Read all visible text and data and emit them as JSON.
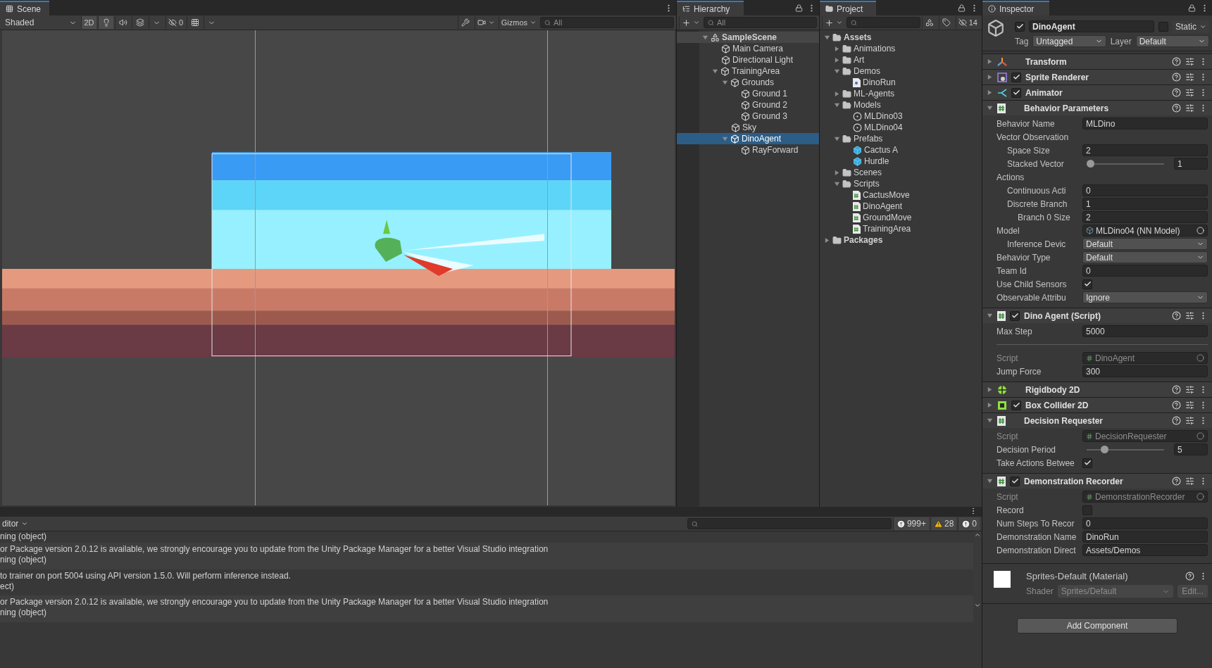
{
  "scene": {
    "tab": "Scene",
    "shading": "Shaded",
    "mode_2d": "2D",
    "hidden_count": "0",
    "gizmos": "Gizmos",
    "search_placeholder": "All"
  },
  "hierarchy": {
    "tab": "Hierarchy",
    "search_placeholder": "All",
    "items": [
      {
        "label": "SampleScene",
        "kind": "scene",
        "expanded": true,
        "selected": false,
        "children": [
          {
            "label": "Main Camera",
            "kind": "object",
            "selected": false
          },
          {
            "label": "Directional Light",
            "kind": "object",
            "selected": false
          },
          {
            "label": "TrainingArea",
            "kind": "object",
            "expanded": true,
            "selected": false,
            "children": [
              {
                "label": "Grounds",
                "kind": "object",
                "expanded": true,
                "selected": false,
                "children": [
                  {
                    "label": "Ground 1",
                    "kind": "object",
                    "selected": false
                  },
                  {
                    "label": "Ground 2",
                    "kind": "object",
                    "selected": false
                  },
                  {
                    "label": "Ground 3",
                    "kind": "object",
                    "selected": false
                  }
                ]
              },
              {
                "label": "Sky",
                "kind": "object",
                "selected": false
              },
              {
                "label": "DinoAgent",
                "kind": "object",
                "expanded": true,
                "selected": true,
                "children": [
                  {
                    "label": "RayForward",
                    "kind": "object",
                    "selected": false
                  }
                ]
              }
            ]
          }
        ]
      }
    ]
  },
  "project": {
    "tab": "Project",
    "hidden_count": "14",
    "items": [
      {
        "label": "Assets",
        "kind": "folder",
        "expanded": true,
        "children": [
          {
            "label": "Animations",
            "kind": "folder",
            "expanded": false
          },
          {
            "label": "Art",
            "kind": "folder",
            "expanded": false
          },
          {
            "label": "Demos",
            "kind": "folder",
            "expanded": true,
            "children": [
              {
                "label": "DinoRun",
                "kind": "demo"
              }
            ]
          },
          {
            "label": "ML-Agents",
            "kind": "folder",
            "expanded": false
          },
          {
            "label": "Models",
            "kind": "folder",
            "expanded": true,
            "children": [
              {
                "label": "MLDino03",
                "kind": "model"
              },
              {
                "label": "MLDino04",
                "kind": "model"
              }
            ]
          },
          {
            "label": "Prefabs",
            "kind": "folder",
            "expanded": true,
            "children": [
              {
                "label": "Cactus A",
                "kind": "prefab"
              },
              {
                "label": "Hurdle",
                "kind": "prefab"
              }
            ]
          },
          {
            "label": "Scenes",
            "kind": "folder",
            "expanded": false
          },
          {
            "label": "Scripts",
            "kind": "folder",
            "expanded": true,
            "children": [
              {
                "label": "CactusMove",
                "kind": "script"
              },
              {
                "label": "DinoAgent",
                "kind": "script"
              },
              {
                "label": "GroundMove",
                "kind": "script"
              },
              {
                "label": "TrainingArea",
                "kind": "script"
              }
            ]
          }
        ]
      },
      {
        "label": "Packages",
        "kind": "folder",
        "expanded": false
      }
    ]
  },
  "inspector": {
    "tab": "Inspector",
    "object": {
      "name": "DinoAgent",
      "active": true,
      "static_label": "Static",
      "static": false,
      "tag_label": "Tag",
      "tag": "Untagged",
      "layer_label": "Layer",
      "layer": "Default"
    },
    "components": [
      {
        "title": "Transform",
        "kind": "transform",
        "expanded": false
      },
      {
        "title": "Sprite Renderer",
        "kind": "sprite",
        "enabled": true,
        "expanded": false
      },
      {
        "title": "Animator",
        "kind": "animator",
        "enabled": true,
        "expanded": false
      },
      {
        "title": "Behavior Parameters",
        "kind": "script",
        "expanded": true,
        "fields": [
          {
            "kind": "text",
            "label": "Behavior Name",
            "value": "MLDino"
          },
          {
            "kind": "header",
            "label": "Vector Observation",
            "children": [
              {
                "kind": "text",
                "label": "Space Size",
                "value": "2"
              },
              {
                "kind": "slider",
                "label": "Stacked Vector",
                "level": 0,
                "value": "1"
              }
            ]
          },
          {
            "kind": "header",
            "label": "Actions",
            "children": [
              {
                "kind": "text",
                "label": "Continuous Acti",
                "value": "0"
              },
              {
                "kind": "text",
                "label": "Discrete Branch",
                "value": "1",
                "children": [
                  {
                    "kind": "text",
                    "label": "Branch 0 Size",
                    "value": "2"
                  }
                ]
              }
            ]
          },
          {
            "kind": "object",
            "label": "Model",
            "value": "MLDino04 (NN Model)",
            "disabled": false,
            "children": [
              {
                "kind": "dropdown",
                "label": "Inference Devic",
                "value": "Default"
              }
            ]
          },
          {
            "kind": "dropdown",
            "label": "Behavior Type",
            "value": "Default"
          },
          {
            "kind": "text",
            "label": "Team Id",
            "value": "0"
          },
          {
            "kind": "checkbox",
            "label": "Use Child Sensors",
            "checked": true
          },
          {
            "kind": "dropdown",
            "label": "Observable Attribu",
            "value": "Ignore"
          }
        ]
      },
      {
        "title": "Dino Agent (Script)",
        "kind": "script",
        "enabled": true,
        "expanded": true,
        "fields": [
          {
            "kind": "text",
            "label": "Max Step",
            "value": "5000"
          },
          {
            "kind": "separator"
          },
          {
            "kind": "object",
            "label": "Script",
            "value": "DinoAgent",
            "disabled": true
          },
          {
            "kind": "text",
            "label": "Jump Force",
            "value": "300"
          }
        ]
      },
      {
        "title": "Rigidbody 2D",
        "kind": "rigidbody",
        "expanded": false
      },
      {
        "title": "Box Collider 2D",
        "kind": "collider",
        "enabled": true,
        "expanded": false
      },
      {
        "title": "Decision Requester",
        "kind": "script",
        "expanded": true,
        "fields": [
          {
            "kind": "object",
            "label": "Script",
            "value": "DecisionRequester",
            "disabled": true
          },
          {
            "kind": "slider",
            "label": "Decision Period",
            "level": 0.2,
            "value": "5"
          },
          {
            "kind": "checkbox",
            "label": "Take Actions Betwee",
            "checked": true
          }
        ]
      },
      {
        "title": "Demonstration Recorder",
        "kind": "script",
        "enabled": true,
        "expanded": true,
        "fields": [
          {
            "kind": "object",
            "label": "Script",
            "value": "DemonstrationRecorder",
            "disabled": true
          },
          {
            "kind": "checkbox",
            "label": "Record",
            "checked": false
          },
          {
            "kind": "text",
            "label": "Num Steps To Recor",
            "value": "0"
          },
          {
            "kind": "text",
            "label": "Demonstration Name",
            "value": "DinoRun"
          },
          {
            "kind": "text",
            "label": "Demonstration Direct",
            "value": "Assets/Demos"
          }
        ]
      }
    ],
    "material": {
      "name": "Sprites-Default (Material)",
      "shader_label": "Shader",
      "shader": "Sprites/Default",
      "edit": "Edit..."
    },
    "add_button": "Add Component"
  },
  "console": {
    "source": "ditor",
    "counts": {
      "messages": "999+",
      "warnings": "28",
      "errors": "0"
    },
    "entries": [
      {
        "lines": [
          "ning (object)"
        ]
      },
      {
        "lines": [
          "or Package version 2.0.12 is available, we strongly encourage you to update from the Unity Package Manager for a better Visual Studio integration",
          "ning (object)"
        ]
      },
      {
        "lines": [
          "to trainer on port 5004 using API version 1.5.0. Will perform inference instead.",
          "ect)"
        ]
      },
      {
        "lines": [
          "or Package version 2.0.12 is available, we strongly encourage you to update from the Unity Package Manager for a better Visual Studio integration",
          "ning (object)"
        ]
      }
    ]
  }
}
